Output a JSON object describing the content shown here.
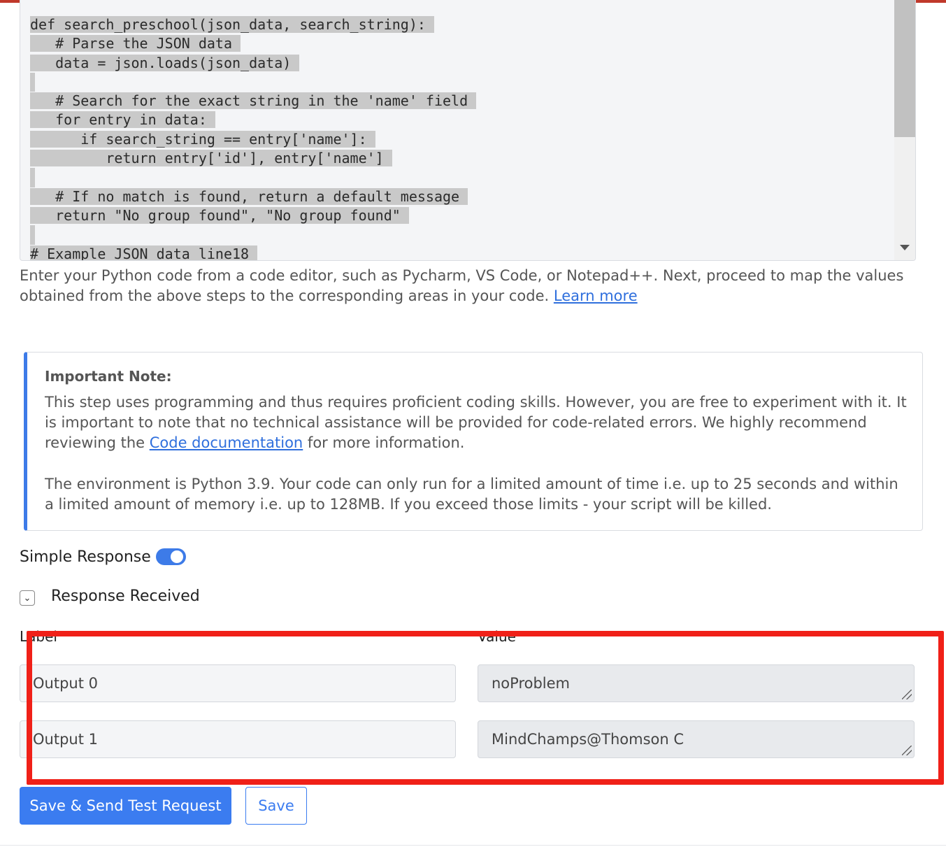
{
  "code_editor": {
    "lines": [
      "def search_preschool(json_data, search_string):",
      "   # Parse the JSON data",
      "   data = json.loads(json_data)",
      "",
      "   # Search for the exact string in the 'name' field",
      "   for entry in data:",
      "      if search_string == entry['name']:",
      "         return entry['id'], entry['name']",
      "",
      "   # If no match is found, return a default message",
      "   return \"No group found\", \"No group found\"",
      "",
      "# Example JSON data line18"
    ]
  },
  "help": {
    "text": "Enter your Python code from a code editor, such as Pycharm, VS Code, or Notepad++. Next, proceed to map the values obtained from the above steps to the corresponding areas in your code. ",
    "learn_more": "Learn more"
  },
  "note": {
    "title": "Important Note:",
    "p1_before": "This step uses programming and thus requires proficient coding skills. However, you are free to experiment with it. It is important to note that no technical assistance will be provided for code-related errors. We highly recommend reviewing the ",
    "p1_link": "Code documentation",
    "p1_after": " for more information.",
    "p2": "The environment is Python 3.9. Your code can only run for a limited amount of time i.e. up to 25 seconds and within a limited amount of memory i.e. up to 128MB. If you exceed those limits - your script will be killed."
  },
  "simple_response": {
    "label": "Simple Response",
    "enabled": true
  },
  "response_received": {
    "label": "Response Received"
  },
  "columns": {
    "label": "Label",
    "value": "Value"
  },
  "outputs": [
    {
      "label": "Output 0",
      "value": "noProblem"
    },
    {
      "label": "Output 1",
      "value": "MindChamps@Thomson C"
    }
  ],
  "buttons": {
    "save_send": "Save & Send Test Request",
    "save": "Save"
  },
  "colors": {
    "accent": "#3b7cf0",
    "highlight": "#f02018"
  }
}
